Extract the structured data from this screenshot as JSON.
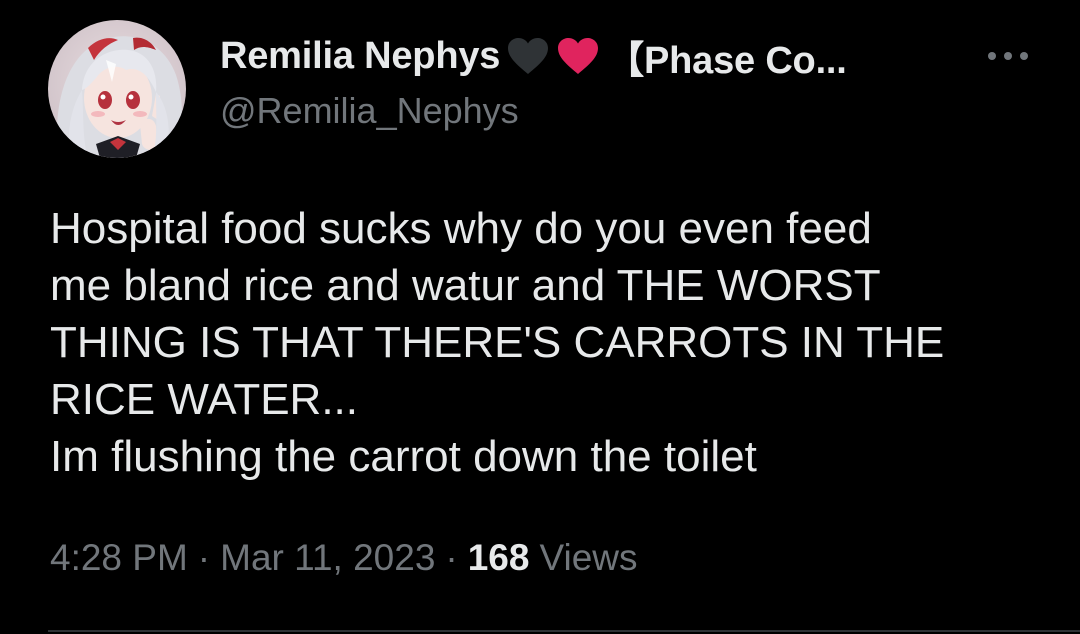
{
  "author": {
    "display_name": "Remilia Nephys",
    "name_suffix": "【Phase Co...",
    "handle": "@Remilia_Nephys",
    "emoji": [
      "black-heart-icon",
      "red-heart-icon"
    ]
  },
  "tweet": {
    "text_lines": [
      "Hospital food sucks why do you even feed",
      "me bland rice and watur and THE WORST",
      "THING IS THAT THERE'S CARROTS IN THE",
      "RICE WATER...",
      "Im flushing the carrot down the toilet"
    ],
    "time": "4:28 PM",
    "separator": "·",
    "date": "Mar 11, 2023",
    "views_count": "168",
    "views_label": "Views"
  },
  "colors": {
    "background": "#000000",
    "primary_text": "#e7e9ea",
    "secondary_text": "#71767b",
    "black_heart": "#2f3336",
    "red_heart": "#e0245e"
  }
}
